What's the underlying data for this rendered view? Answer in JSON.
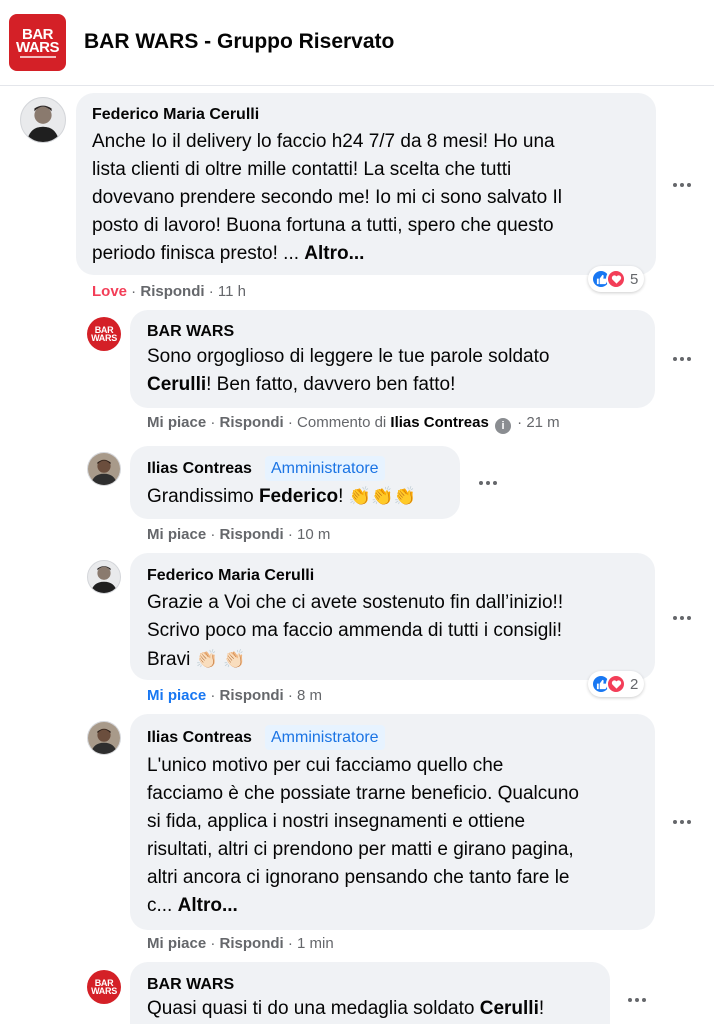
{
  "header": {
    "logo_line1": "BAR",
    "logo_line2": "WARS",
    "title": "BAR WARS - Gruppo Riservato"
  },
  "colors": {
    "accent": "#1877f2",
    "brand_red": "#d42027",
    "love": "#f33e58",
    "bubble": "#f0f2f5",
    "meta": "#65676b"
  },
  "comments": [
    {
      "author": "Federico Maria Cerulli",
      "lines": [
        "Anche Io il delivery lo faccio h24 7/7 da 8 mesi! Ho una",
        "lista clienti di oltre mille contatti! La scelta che tutti",
        "dovevano prendere secondo me! Io mi ci sono salvato Il",
        "posto di lavoro! Buona fortuna a tutti, spero che questo",
        "periodo finisca presto! ..."
      ],
      "more": "Altro...",
      "reaction_label": "Love",
      "reply": "Rispondi",
      "time": "11 h",
      "reaction_count": "5"
    },
    {
      "author": "BAR WARS",
      "line1": "Sono orgoglioso di leggere le tue parole soldato",
      "line2_bold": "Cerulli",
      "line2_rest": "! Ben fatto, davvero ben fatto!",
      "like": "Mi piace",
      "reply": "Rispondi",
      "comment_by_label": "Commento di",
      "comment_by_name": "Ilias Contreas",
      "time": "21 m"
    },
    {
      "author": "Ilias Contreas",
      "badge": "Amministratore",
      "text_pre": "Grandissimo",
      "text_bold": "Federico",
      "text_post": "!",
      "emoji": "👏👏👏",
      "like": "Mi piace",
      "reply": "Rispondi",
      "time": "10 m"
    },
    {
      "author": "Federico Maria Cerulli",
      "lines": [
        "Grazie a Voi che ci avete sostenuto fin dall’inizio!!",
        "Scrivo poco ma faccio ammenda di tutti i consigli!"
      ],
      "line3": "Bravi",
      "emoji": "👏🏻 👏🏻",
      "like": "Mi piace",
      "reply": "Rispondi",
      "time": "8 m",
      "reaction_count": "2"
    },
    {
      "author": "Ilias Contreas",
      "badge": "Amministratore",
      "lines": [
        "L'unico motivo per cui facciamo quello che",
        "facciamo è che possiate trarne beneficio. Qualcuno",
        "si fida, applica i nostri insegnamenti e ottiene",
        "risultati, altri ci prendono per matti e girano pagina,",
        "altri ancora ci ignorano pensando che tanto fare le",
        "c..."
      ],
      "more": "Altro...",
      "like": "Mi piace",
      "reply": "Rispondi",
      "time": "1 min"
    },
    {
      "author": "BAR WARS",
      "text_pre": "Quasi quasi ti do una medaglia soldato",
      "text_bold": "Cerulli",
      "text_post": "!"
    }
  ]
}
